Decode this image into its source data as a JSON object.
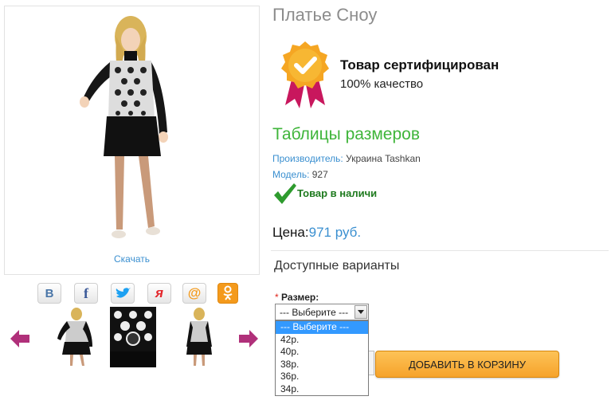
{
  "product": {
    "title": "Платье Сноу",
    "download_label": "Скачать"
  },
  "share_buttons": [
    {
      "name": "vk-icon",
      "glyph": "B",
      "color": "#4a76a8"
    },
    {
      "name": "facebook-icon",
      "glyph": "f",
      "color": "#3b5998"
    },
    {
      "name": "twitter-icon",
      "glyph": "",
      "color": "#1da1f2"
    },
    {
      "name": "yaru-icon",
      "glyph": "я",
      "color": "#e3262b"
    },
    {
      "name": "mail-ru-icon",
      "glyph": "@",
      "color": "#f49a1c"
    },
    {
      "name": "odnoklassniki-icon",
      "glyph": "ок",
      "color": "#ffffff"
    }
  ],
  "certificate": {
    "title": "Товар сертифицирован",
    "subtitle": "100% качество"
  },
  "size_table_link": "Таблицы размеров",
  "manufacturer": {
    "label": "Производитель:",
    "value": "Украина Tashkan"
  },
  "model": {
    "label": "Модель:",
    "value": "927"
  },
  "stock_status": "Товар в наличи",
  "price": {
    "label": "Цена:",
    "value": "971 руб."
  },
  "variants_title": "Доступные варианты",
  "size_option": {
    "required_mark": "*",
    "label": "Размер:",
    "selected": "--- Выберите ---",
    "options": [
      "--- Выберите ---",
      "42р.",
      "40р.",
      "38р.",
      "36р.",
      "34р."
    ]
  },
  "cart_button": "ДОБАВИТЬ В КОРЗИНУ",
  "colors": {
    "accent_blue": "#3a8fd0",
    "green": "#3fb53a",
    "cart_orange": "#f6a32b",
    "arrow_purple": "#b0307a"
  }
}
